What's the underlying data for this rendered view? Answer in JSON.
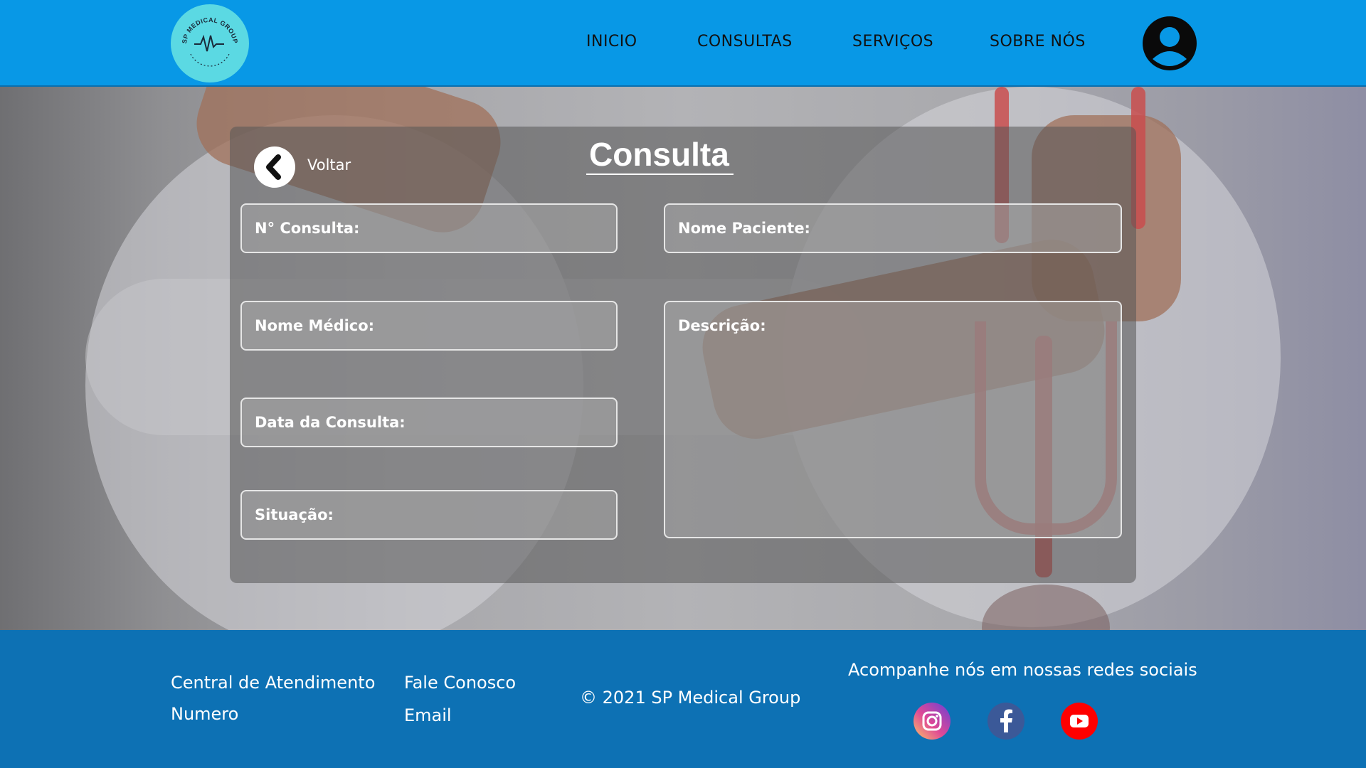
{
  "header": {
    "logo_text": "SP MEDICAL GROUP",
    "nav": [
      "INICIO",
      "CONSULTAS",
      "SERVIÇOS",
      "SOBRE NÓS"
    ],
    "avatar_icon": "user-circle-icon"
  },
  "page": {
    "back_label": "Voltar",
    "title": "Consulta",
    "fields": {
      "numero": "N° Consulta:",
      "paciente": "Nome Paciente:",
      "medico": "Nome Médico:",
      "descricao": "Descrição:",
      "data": "Data da Consulta:",
      "situacao": "Situação:"
    }
  },
  "footer": {
    "central": "Central de Atendimento",
    "numero": "Numero",
    "fale": "Fale Conosco",
    "email": "Email",
    "copyright": "© 2021 SP Medical Group",
    "social_title": "Acompanhe nós em nossas redes sociais",
    "social": [
      "instagram-icon",
      "facebook-icon",
      "youtube-icon"
    ]
  },
  "colors": {
    "header": "#0898e6",
    "footer": "#0d71b4",
    "logo": "#5bd9e3",
    "youtube": "#ff0000",
    "facebook": "#3b5998"
  }
}
